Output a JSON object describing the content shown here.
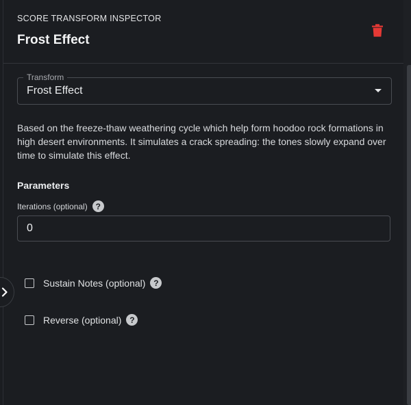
{
  "header": {
    "overline": "SCORE TRANSFORM INSPECTOR",
    "title": "Frost Effect",
    "delete_icon": "trash-icon",
    "delete_color": "#e53935"
  },
  "transform_select": {
    "label": "Transform",
    "value": "Frost Effect"
  },
  "description": "Based on the freeze-thaw weathering cycle which help form hoodoo rock formations in high desert environments. It simulates a crack spreading: the tones slowly expand over time to simulate this effect.",
  "parameters": {
    "heading": "Parameters",
    "iterations": {
      "label": "Iterations (optional)",
      "value": "0"
    },
    "sustain_notes": {
      "label": "Sustain Notes (optional)",
      "checked": false
    },
    "reverse": {
      "label": "Reverse (optional)",
      "checked": false
    }
  },
  "help_glyph": "?"
}
